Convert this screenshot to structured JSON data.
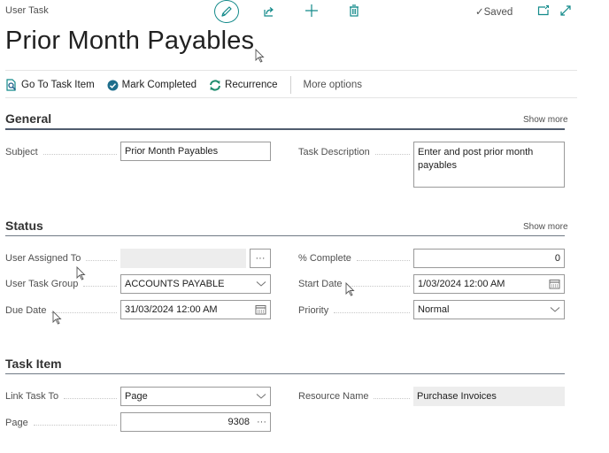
{
  "header": {
    "caption": "User Task",
    "title": "Prior Month Payables",
    "saved_label": "Saved",
    "toolbar_icons": [
      "edit-pencil-icon",
      "share-icon",
      "new-plus-icon",
      "delete-trash-icon",
      "open-new-window-icon",
      "expand-icon"
    ]
  },
  "actions": {
    "go_to_task_item": "Go To Task Item",
    "mark_completed": "Mark Completed",
    "recurrence": "Recurrence",
    "more_options": "More options"
  },
  "general": {
    "title": "General",
    "show_more": "Show more",
    "subject_label": "Subject",
    "subject_value": "Prior Month Payables",
    "task_description_label": "Task Description",
    "task_description_value": "Enter and post prior month payables"
  },
  "status": {
    "title": "Status",
    "show_more": "Show more",
    "user_assigned_to_label": "User Assigned To",
    "user_assigned_to_value": "",
    "user_task_group_label": "User Task Group",
    "user_task_group_value": "ACCOUNTS PAYABLE",
    "due_date_label": "Due Date",
    "due_date_value": "31/03/2024 12:00 AM",
    "percent_complete_label": "% Complete",
    "percent_complete_value": "0",
    "start_date_label": "Start Date",
    "start_date_value": "1/03/2024 12:00 AM",
    "priority_label": "Priority",
    "priority_value": "Normal"
  },
  "task_item": {
    "title": "Task Item",
    "link_task_to_label": "Link Task To",
    "link_task_to_value": "Page",
    "page_label": "Page",
    "page_value": "9308",
    "resource_name_label": "Resource Name",
    "resource_name_value": "Purchase Invoices"
  },
  "colors": {
    "accent": "#138a8a",
    "section_line": "#505c6e",
    "read_only_bg": "#ededed"
  }
}
